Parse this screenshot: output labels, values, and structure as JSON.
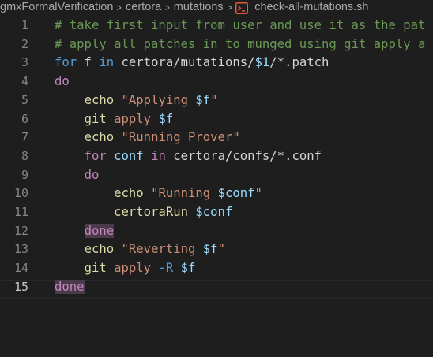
{
  "breadcrumb": {
    "items": [
      "gmxFormalVerification",
      "certora",
      "mutations"
    ],
    "file": "check-all-mutations.sh",
    "file_icon": "terminal-icon"
  },
  "editor": {
    "active_line": 15,
    "lines": [
      {
        "n": "1",
        "tokens": [
          {
            "t": "# take first input from user and use it as the pat",
            "c": "cm"
          }
        ]
      },
      {
        "n": "2",
        "tokens": [
          {
            "t": "# apply all patches in to munged using git apply a",
            "c": "cm"
          }
        ]
      },
      {
        "n": "3",
        "tokens": [
          {
            "t": "for",
            "c": "kb"
          },
          {
            "t": " f ",
            "c": "txt"
          },
          {
            "t": "in",
            "c": "kb"
          },
          {
            "t": " certora/mutations/",
            "c": "txt"
          },
          {
            "t": "$1",
            "c": "var"
          },
          {
            "t": "/*.patch",
            "c": "txt"
          }
        ]
      },
      {
        "n": "4",
        "tokens": [
          {
            "t": "do",
            "c": "kw"
          }
        ]
      },
      {
        "n": "5",
        "tokens": [
          {
            "t": "    ",
            "c": "txt"
          },
          {
            "t": "echo",
            "c": "cmd"
          },
          {
            "t": " ",
            "c": "txt"
          },
          {
            "t": "\"Applying ",
            "c": "str"
          },
          {
            "t": "$f",
            "c": "var"
          },
          {
            "t": "\"",
            "c": "str"
          }
        ]
      },
      {
        "n": "6",
        "tokens": [
          {
            "t": "    ",
            "c": "txt"
          },
          {
            "t": "git",
            "c": "cmd"
          },
          {
            "t": " ",
            "c": "txt"
          },
          {
            "t": "apply",
            "c": "str"
          },
          {
            "t": " ",
            "c": "txt"
          },
          {
            "t": "$f",
            "c": "var"
          }
        ]
      },
      {
        "n": "7",
        "tokens": [
          {
            "t": "    ",
            "c": "txt"
          },
          {
            "t": "echo",
            "c": "cmd"
          },
          {
            "t": " ",
            "c": "txt"
          },
          {
            "t": "\"Running Prover\"",
            "c": "str"
          }
        ]
      },
      {
        "n": "8",
        "tokens": [
          {
            "t": "    ",
            "c": "txt"
          },
          {
            "t": "for",
            "c": "kw"
          },
          {
            "t": " ",
            "c": "txt"
          },
          {
            "t": "conf",
            "c": "var"
          },
          {
            "t": " ",
            "c": "txt"
          },
          {
            "t": "in",
            "c": "kw"
          },
          {
            "t": " certora/confs/*.conf",
            "c": "txt"
          }
        ]
      },
      {
        "n": "9",
        "tokens": [
          {
            "t": "    ",
            "c": "txt"
          },
          {
            "t": "do",
            "c": "kw"
          }
        ]
      },
      {
        "n": "10",
        "tokens": [
          {
            "t": "        ",
            "c": "txt"
          },
          {
            "t": "echo",
            "c": "cmd"
          },
          {
            "t": " ",
            "c": "txt"
          },
          {
            "t": "\"Running ",
            "c": "str"
          },
          {
            "t": "$conf",
            "c": "var"
          },
          {
            "t": "\"",
            "c": "str"
          }
        ]
      },
      {
        "n": "11",
        "tokens": [
          {
            "t": "        ",
            "c": "txt"
          },
          {
            "t": "certoraRun",
            "c": "cmd"
          },
          {
            "t": " ",
            "c": "txt"
          },
          {
            "t": "$conf",
            "c": "var"
          }
        ]
      },
      {
        "n": "12",
        "tokens": [
          {
            "t": "    ",
            "c": "txt"
          },
          {
            "t": "done",
            "c": "kw",
            "hl": true
          }
        ]
      },
      {
        "n": "13",
        "tokens": [
          {
            "t": "    ",
            "c": "txt"
          },
          {
            "t": "echo",
            "c": "cmd"
          },
          {
            "t": " ",
            "c": "txt"
          },
          {
            "t": "\"Reverting ",
            "c": "str"
          },
          {
            "t": "$f",
            "c": "var"
          },
          {
            "t": "\"",
            "c": "str"
          }
        ]
      },
      {
        "n": "14",
        "tokens": [
          {
            "t": "    ",
            "c": "txt"
          },
          {
            "t": "git",
            "c": "cmd"
          },
          {
            "t": " ",
            "c": "txt"
          },
          {
            "t": "apply",
            "c": "str"
          },
          {
            "t": " ",
            "c": "txt"
          },
          {
            "t": "-R",
            "c": "opt"
          },
          {
            "t": " ",
            "c": "txt"
          },
          {
            "t": "$f",
            "c": "var"
          }
        ]
      },
      {
        "n": "15",
        "tokens": [
          {
            "t": "done",
            "c": "kw",
            "hl": true
          }
        ]
      }
    ]
  }
}
